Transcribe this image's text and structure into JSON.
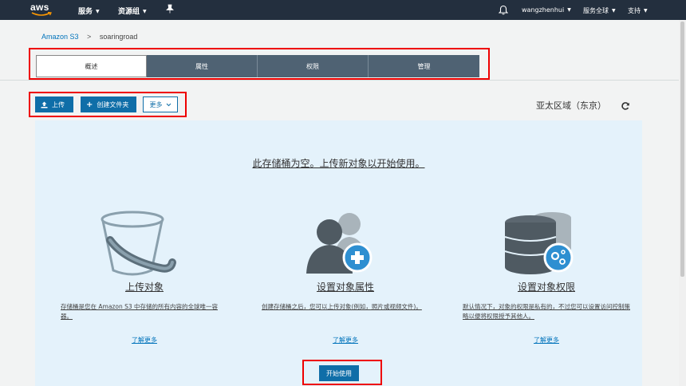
{
  "topnav": {
    "logo": "aws",
    "services": "服务",
    "resource_groups": "资源组",
    "user": "wangzhenhui",
    "region_menu": "服务全球",
    "support": "支持"
  },
  "breadcrumb": {
    "root": "Amazon S3",
    "separator": ">",
    "current": "soaringroad"
  },
  "tabs": [
    "概述",
    "属性",
    "权限",
    "管理"
  ],
  "toolbar": {
    "upload": "上传",
    "create_folder": "创建文件夹",
    "more": "更多"
  },
  "region": "亚太区域（东京）",
  "empty_state": {
    "headline": "此存储桶为空。上传新对象以开始使用。",
    "columns": [
      {
        "icon": "bucket-icon",
        "title": "上传对象",
        "desc": "存储桶是您在 Amazon S3 中存储的所有内容的全球唯一容器。",
        "link": "了解更多"
      },
      {
        "icon": "user-add-icon",
        "title": "设置对象属性",
        "desc": "创建存储桶之后，您可以上传对象(例如，照片或视频文件)。",
        "link": "了解更多"
      },
      {
        "icon": "database-settings-icon",
        "title": "设置对象权限",
        "desc": "默认情况下，对象的权限是私有的，不过您可以设置访问控制策略以便将权限授予其他人。",
        "link": "了解更多"
      }
    ],
    "start_button": "开始使用"
  },
  "colors": {
    "nav_bg": "#232f3e",
    "primary": "#0f6ea8",
    "tab_inactive": "#4f6273",
    "panel_bg": "#e4f2fb",
    "highlight": "#ee0000"
  }
}
